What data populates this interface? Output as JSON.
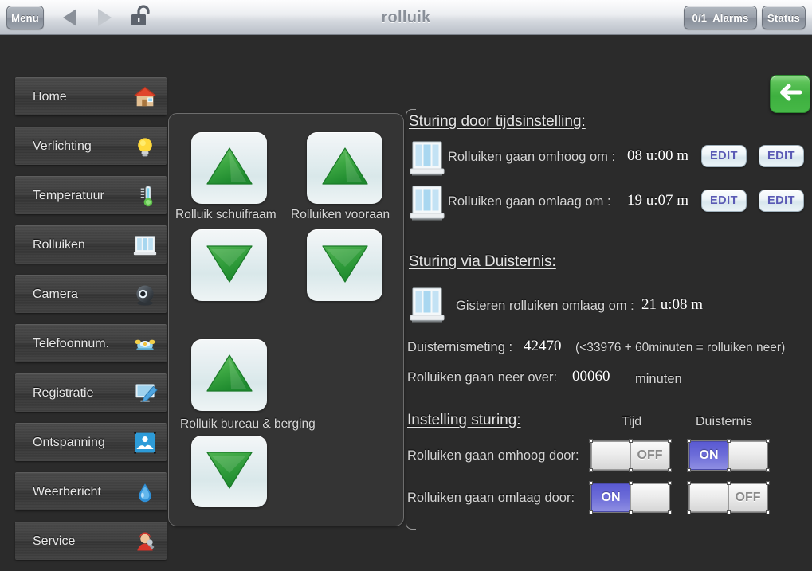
{
  "window": {
    "title": "rolluik",
    "menu_label": "Menu",
    "alarms_count": "0/1",
    "alarms_label": "Alarms",
    "status_label": "Status",
    "back_nav_icon": "triangle-left-icon",
    "forward_nav_icon": "triangle-right-icon",
    "lock_icon": "unlocked-padlock-icon"
  },
  "colors": {
    "accent_green": "#3eb03f",
    "toggle_on": "#5a5ad2",
    "edit_text": "#5a5ab5",
    "background": "#2b2b2b",
    "panel": "#343434"
  },
  "sidebar": {
    "items": [
      {
        "label": "Home",
        "icon": "house-icon"
      },
      {
        "label": "Verlichting",
        "icon": "lightbulb-icon"
      },
      {
        "label": "Temperatuur",
        "icon": "thermometer-icon"
      },
      {
        "label": "Rolluiken",
        "icon": "window-shutter-icon"
      },
      {
        "label": "Camera",
        "icon": "camera-icon"
      },
      {
        "label": "Telefoonnum.",
        "icon": "telephone-icon"
      },
      {
        "label": "Registratie",
        "icon": "screen-pencil-icon"
      },
      {
        "label": "Ontspanning",
        "icon": "relaxation-icon"
      },
      {
        "label": "Weerbericht",
        "icon": "water-drop-icon"
      },
      {
        "label": "Service",
        "icon": "worker-wrench-icon"
      }
    ]
  },
  "shutter_controls": {
    "groups": [
      {
        "label": "Rolluik schuifraam",
        "up_icon": "triangle-up-icon",
        "down_icon": "triangle-down-icon"
      },
      {
        "label": "Rolluiken vooraan",
        "up_icon": "triangle-up-icon",
        "down_icon": "triangle-down-icon"
      },
      {
        "label": "Rolluik bureau & berging",
        "up_icon": "triangle-up-icon",
        "down_icon": "triangle-down-icon"
      }
    ]
  },
  "time_section": {
    "heading": "Sturing door tijdsinstelling:",
    "rows": [
      {
        "icon": "window-shutter-icon",
        "label": "Rolluiken gaan omhoog om :",
        "value": "08 u:00 m",
        "edit_label_1": "EDIT",
        "edit_label_2": "EDIT"
      },
      {
        "icon": "window-shutter-icon",
        "label": "Rolluiken gaan omlaag om :",
        "value": "19 u:07 m",
        "edit_label_1": "EDIT",
        "edit_label_2": "EDIT"
      }
    ]
  },
  "darkness_section": {
    "heading": "Sturing via Duisternis:",
    "icon": "window-shutter-icon",
    "yesterday_label": "Gisteren rolluiken omlaag om :",
    "yesterday_value": "21 u:08 m",
    "measure_label": "Duisternismeting :",
    "measure_value": "42470",
    "measure_note": "(<33976 + 60minuten = rolluiken neer)",
    "countdown_label": "Rolluiken gaan neer over:",
    "countdown_value": "00060",
    "countdown_unit": "minuten"
  },
  "settings_section": {
    "heading": "Instelling sturing:",
    "col_time": "Tijd",
    "col_darkness": "Duisternis",
    "rows": [
      {
        "label": "Rolluiken gaan omhoog door:",
        "time_state": "OFF",
        "time_on_text": "",
        "time_off_text": "OFF",
        "darkness_state": "ON",
        "darkness_on_text": "ON",
        "darkness_off_text": ""
      },
      {
        "label": "Rolluiken gaan omlaag door:",
        "time_state": "ON",
        "time_on_text": "ON",
        "time_off_text": "",
        "darkness_state": "OFF",
        "darkness_on_text": "",
        "darkness_off_text": "OFF"
      }
    ]
  },
  "back_button": {
    "icon": "arrow-left-icon"
  }
}
